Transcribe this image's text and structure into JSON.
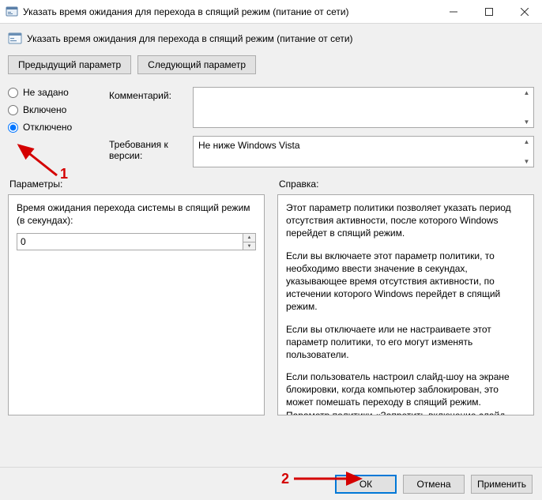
{
  "window": {
    "title": "Указать время ожидания для перехода в спящий режим (питание от сети)"
  },
  "header": {
    "title": "Указать время ожидания для перехода в спящий режим (питание от сети)"
  },
  "nav": {
    "prev": "Предыдущий параметр",
    "next": "Следующий параметр"
  },
  "state": {
    "not_configured": "Не задано",
    "enabled": "Включено",
    "disabled": "Отключено",
    "selected": "disabled"
  },
  "fields": {
    "comment_label": "Комментарий:",
    "comment_value": "",
    "requirements_label": "Требования к версии:",
    "requirements_value": "Не ниже Windows Vista"
  },
  "panes": {
    "options_label": "Параметры:",
    "help_label": "Справка:"
  },
  "options": {
    "param_label": "Время ожидания перехода системы в спящий режим (в секундах):",
    "param_value": "0"
  },
  "help": {
    "p1": "Этот параметр политики позволяет указать период отсутствия активности, после которого Windows перейдет в спящий режим.",
    "p2": "Если вы включаете этот параметр политики, то необходимо ввести значение в секундах, указывающее время отсутствия активности, по истечении которого Windows перейдет в спящий режим.",
    "p3": "Если вы отключаете или не настраиваете этот параметр политики, то его могут изменять пользователи.",
    "p4": "Если пользователь настроил слайд-шоу на экране блокировки, когда компьютер заблокирован, это может помешать переходу в спящий режим.  Параметр политики «Запретить включение слайд-шоу с экрана блокировки» позволяет отключить слайд-шоу."
  },
  "footer": {
    "ok": "ОК",
    "cancel": "Отмена",
    "apply": "Применить"
  },
  "annotations": {
    "a1": "1",
    "a2": "2"
  }
}
